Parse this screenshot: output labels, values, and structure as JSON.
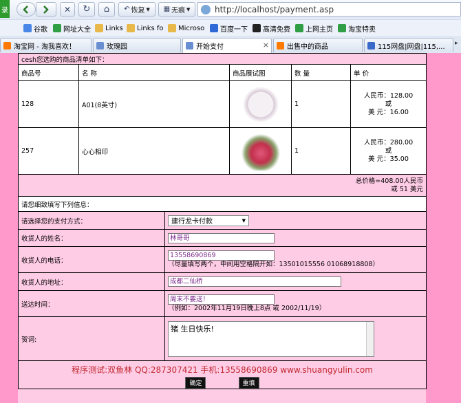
{
  "browser": {
    "side_label": "录",
    "back_icon": "back-arrow-icon",
    "forward_icon": "forward-arrow-icon",
    "stop_symbol": "✕",
    "refresh_symbol": "↻",
    "home_symbol": "⌂",
    "restore_label": "恢复",
    "nopic_label": "无痕",
    "address": "http://localhost/payment.asp"
  },
  "favorites": [
    {
      "label": "谷歌",
      "color": "#4a86e8"
    },
    {
      "label": "网址大全",
      "color": "#2f9e44"
    },
    {
      "label": "Links",
      "color": "#e8b84a"
    },
    {
      "label": "Links fo",
      "color": "#e8b84a"
    },
    {
      "label": "Microso",
      "color": "#e8b84a"
    },
    {
      "label": "百度一下",
      "color": "#3068d8"
    },
    {
      "label": "高清免费",
      "color": "#222222"
    },
    {
      "label": "上网主页",
      "color": "#2f9e44"
    },
    {
      "label": "淘宝特卖",
      "color": "#2f9e44"
    }
  ],
  "tabs": [
    {
      "label": "淘宝网 - 淘我喜欢！",
      "color": "#ff7a00"
    },
    {
      "label": "玫瑰园",
      "color": "#6a8fd0"
    },
    {
      "label": "开始支付",
      "color": "#6a8fd0"
    },
    {
      "label": "出售中的商品",
      "color": "#ff7a00"
    },
    {
      "label": "115网盘|网盘|115,...",
      "color": "#3a6ac8"
    }
  ],
  "tab_close": "×",
  "order": {
    "intro": "cesh您选购的商品清单如下：",
    "headers": [
      "商品号",
      "名 称",
      "商品展试图",
      "数 量",
      "单 价"
    ],
    "items": [
      {
        "id": "128",
        "name": "A01(8英寸)",
        "image": "cake-image",
        "qty": "1",
        "rmb": "人民币：128.00",
        "or": "或",
        "usd": "美 元：16.00"
      },
      {
        "id": "257",
        "name": "心心相印",
        "image": "heart-flower-image",
        "qty": "1",
        "rmb": "人民币：280.00",
        "or": "或",
        "usd": "美 元：35.00"
      }
    ],
    "total_line1": "总价格=408.00人民币",
    "total_line2": "或 51 美元"
  },
  "form": {
    "title": "请您细致填写下列信息：",
    "pay_label": "请选择您的支付方式：",
    "pay_value": "建行龙卡付款",
    "name_label": "收货人的姓名：",
    "name_value": "林哥哥",
    "phone_label": "收货人的电话：",
    "phone_value": "13558690869",
    "phone_hint": "（尽量填写两个，中间用空格隔开如：13501015556 01068918808）",
    "addr_label": "收货人的地址：",
    "addr_value": "成都二仙桥",
    "time_label": "送达时间：",
    "time_value": "周末不要送！",
    "time_hint": "（例如：2002年11月19日晚上8点 或 2002/11/19）",
    "wish_label": "贺词:",
    "wish_value": "猪 生日快乐!"
  },
  "footer": {
    "credit": "程序测试:双鱼林 QQ:287307421 手机:13558690869 www.shuangyulin.com",
    "ok_label": "确定",
    "reset_label": "重填"
  },
  "colors": {
    "page_bg": "#ff99cc",
    "panel_bg": "#ffcce6",
    "credit": "#c0282e"
  }
}
